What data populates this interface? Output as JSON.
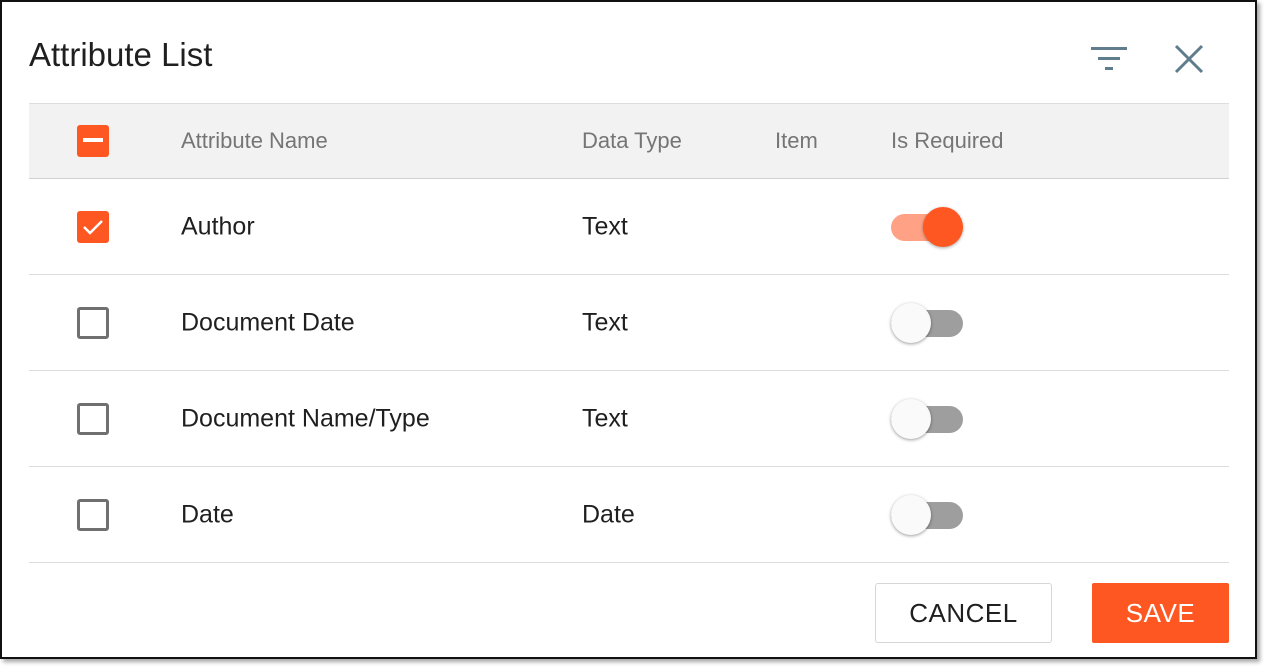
{
  "dialog": {
    "title": "Attribute List"
  },
  "icons": {
    "filter": "filter-icon",
    "close": "close-icon"
  },
  "colors": {
    "accent": "#ff5722",
    "accent_light": "#ffa184",
    "header_bg": "#f2f2f2"
  },
  "table": {
    "select_all_state": "indeterminate",
    "columns": {
      "name": "Attribute Name",
      "type": "Data Type",
      "item": "Item",
      "required": "Is Required"
    },
    "rows": [
      {
        "checked": true,
        "name": "Author",
        "type": "Text",
        "item": "",
        "required": true
      },
      {
        "checked": false,
        "name": "Document Date",
        "type": "Text",
        "item": "",
        "required": false
      },
      {
        "checked": false,
        "name": "Document Name/Type",
        "type": "Text",
        "item": "",
        "required": false
      },
      {
        "checked": false,
        "name": "Date",
        "type": "Date",
        "item": "",
        "required": false
      }
    ]
  },
  "actions": {
    "cancel": "CANCEL",
    "save": "SAVE"
  }
}
